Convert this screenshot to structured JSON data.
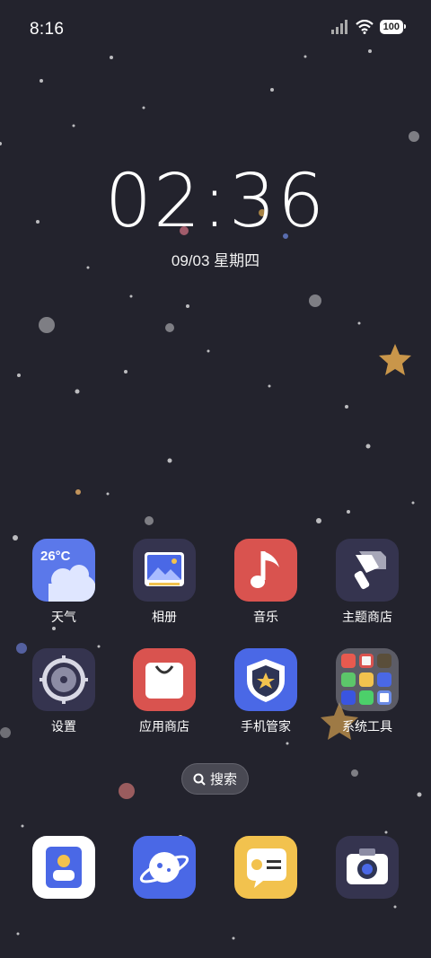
{
  "status_bar": {
    "time": "8:16",
    "battery": "100"
  },
  "lockclock": {
    "time": "02:36",
    "date": "09/03 星期四"
  },
  "apps": [
    {
      "label": "天气",
      "icon": "weather-icon",
      "temp": "26°C"
    },
    {
      "label": "相册",
      "icon": "gallery-icon"
    },
    {
      "label": "音乐",
      "icon": "music-icon"
    },
    {
      "label": "主题商店",
      "icon": "theme-store-icon"
    },
    {
      "label": "设置",
      "icon": "settings-icon"
    },
    {
      "label": "应用商店",
      "icon": "app-store-icon"
    },
    {
      "label": "手机管家",
      "icon": "phone-manager-icon"
    },
    {
      "label": "系统工具",
      "icon": "folder-icon"
    }
  ],
  "search": {
    "label": "搜索"
  },
  "dock": [
    {
      "icon": "contacts-icon"
    },
    {
      "icon": "browser-icon"
    },
    {
      "icon": "messages-icon"
    },
    {
      "icon": "camera-icon"
    }
  ],
  "colors": {
    "background": "#23232d",
    "icon_dark": "#35344f",
    "icon_red": "#d9534f",
    "icon_blue": "#4a68e6",
    "icon_yellow": "#f2c24e"
  }
}
